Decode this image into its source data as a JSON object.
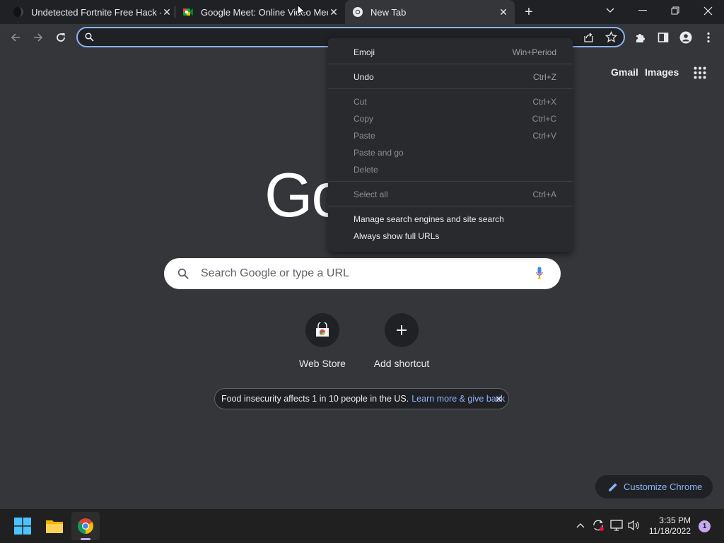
{
  "tabs": [
    {
      "title": "Undetected Fortnite Free Hack -",
      "icon": "dark-circle-icon"
    },
    {
      "title": "Google Meet: Online Video Meet",
      "icon": "google-meet-icon"
    },
    {
      "title": "New Tab",
      "icon": "chrome-icon"
    }
  ],
  "omnibox": {
    "value": "",
    "placeholder": ""
  },
  "top_links": {
    "gmail": "Gmail",
    "images": "Images"
  },
  "logo_text": "Go",
  "search": {
    "placeholder": "Search Google or type a URL"
  },
  "shortcuts": [
    {
      "label": "Web Store"
    },
    {
      "label": "Add shortcut"
    }
  ],
  "promo": {
    "text": "Food insecurity affects 1 in 10 people in the US.",
    "link": "Learn more & give back"
  },
  "customize_label": "Customize Chrome",
  "context_menu": {
    "emoji": {
      "label": "Emoji",
      "shortcut": "Win+Period"
    },
    "undo": {
      "label": "Undo",
      "shortcut": "Ctrl+Z"
    },
    "cut": {
      "label": "Cut",
      "shortcut": "Ctrl+X"
    },
    "copy": {
      "label": "Copy",
      "shortcut": "Ctrl+C"
    },
    "paste": {
      "label": "Paste",
      "shortcut": "Ctrl+V"
    },
    "paste_go": {
      "label": "Paste and go"
    },
    "delete": {
      "label": "Delete"
    },
    "select_all": {
      "label": "Select all",
      "shortcut": "Ctrl+A"
    },
    "manage": {
      "label": "Manage search engines and site search"
    },
    "full_urls": {
      "label": "Always show full URLs"
    }
  },
  "taskbar": {
    "time": "3:35 PM",
    "date": "11/18/2022",
    "notification_count": "1"
  },
  "colors": {
    "accent": "#8ab4f8",
    "background": "#35363a",
    "tabstrip": "#202124"
  }
}
